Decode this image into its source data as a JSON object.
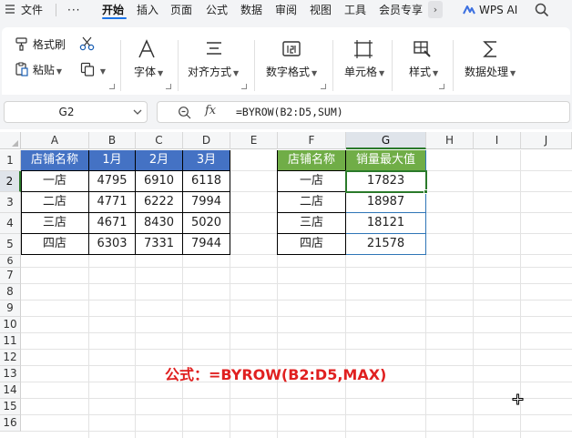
{
  "menu": {
    "items": [
      "文件",
      "开始",
      "插入",
      "页面",
      "公式",
      "数据",
      "审阅",
      "视图",
      "工具",
      "会员专享"
    ],
    "more_label": "···",
    "active": "开始",
    "wps_ai": "WPS AI"
  },
  "ribbon": {
    "format_painter": "格式刷",
    "paste": "粘贴",
    "font": "字体",
    "align": "对齐方式",
    "number_format": "数字格式",
    "cell": "单元格",
    "style": "样式",
    "data_process": "数据处理"
  },
  "formula_bar": {
    "cell_ref": "G2",
    "fx": "fx",
    "formula": "=BYROW(B2:D5,SUM)"
  },
  "sheet": {
    "columns": [
      "A",
      "B",
      "C",
      "D",
      "E",
      "F",
      "G",
      "H",
      "I",
      "J"
    ],
    "rows": [
      "1",
      "2",
      "3",
      "4",
      "5",
      "6",
      "7",
      "8",
      "9",
      "10",
      "11",
      "12",
      "13",
      "14",
      "15",
      "16"
    ],
    "source_table": {
      "headers": [
        "店铺名称",
        "1月",
        "2月",
        "3月"
      ],
      "rows": [
        [
          "一店",
          "4795",
          "6910",
          "6118"
        ],
        [
          "二店",
          "4771",
          "6222",
          "7994"
        ],
        [
          "三店",
          "4671",
          "8430",
          "5020"
        ],
        [
          "四店",
          "6303",
          "7331",
          "7944"
        ]
      ]
    },
    "result_table": {
      "headers": [
        "店铺名称",
        "销量最大值"
      ],
      "rows": [
        [
          "一店",
          "17823"
        ],
        [
          "二店",
          "18987"
        ],
        [
          "三店",
          "18121"
        ],
        [
          "四店",
          "21578"
        ]
      ]
    },
    "note": "公式：=BYROW(B2:D5,MAX)",
    "colors": {
      "header_blue": "#4472c4",
      "header_green": "#70ad47",
      "note_red": "#e02020",
      "selection_green": "#2a7a2a"
    }
  }
}
